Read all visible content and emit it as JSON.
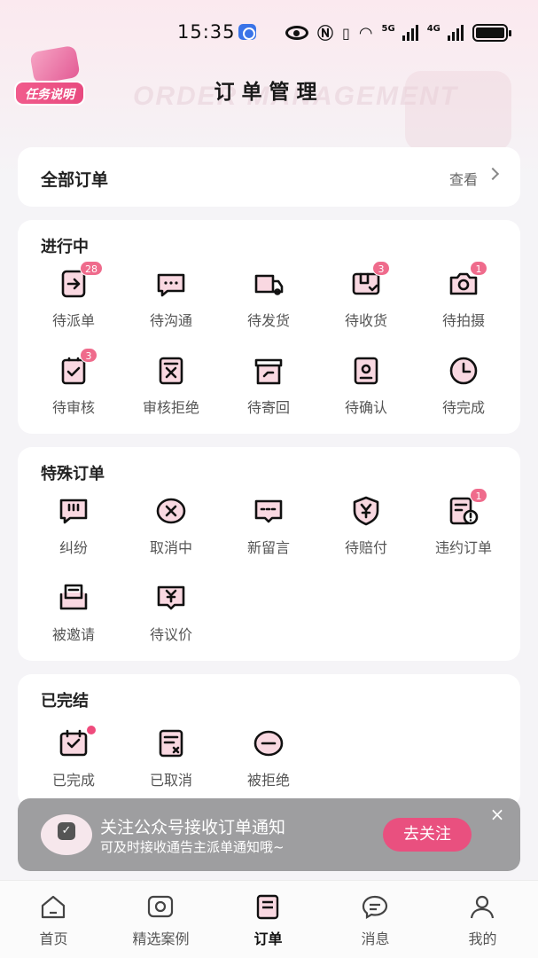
{
  "status_bar": {
    "time": "15:35",
    "network_1": "5G",
    "network_2": "4G"
  },
  "header": {
    "task_button": "任务说明",
    "title": "订单管理",
    "watermark": "ORDER MANAGEMENT"
  },
  "all_orders": {
    "title": "全部订单",
    "view_label": "查看"
  },
  "in_progress": {
    "title": "进行中",
    "items": [
      {
        "label": "待派单",
        "icon": "dispatch-icon",
        "badge": "28"
      },
      {
        "label": "待沟通",
        "icon": "chat-icon",
        "badge": ""
      },
      {
        "label": "待发货",
        "icon": "truck-icon",
        "badge": ""
      },
      {
        "label": "待收货",
        "icon": "receive-box-icon",
        "badge": "3"
      },
      {
        "label": "待拍摄",
        "icon": "camera-icon",
        "badge": "1"
      },
      {
        "label": "待审核",
        "icon": "review-doc-icon",
        "badge": "3"
      },
      {
        "label": "审核拒绝",
        "icon": "reject-doc-icon",
        "badge": ""
      },
      {
        "label": "待寄回",
        "icon": "return-box-icon",
        "badge": ""
      },
      {
        "label": "待确认",
        "icon": "confirm-doc-icon",
        "badge": ""
      },
      {
        "label": "待完成",
        "icon": "clock-icon",
        "badge": ""
      }
    ]
  },
  "special_orders": {
    "title": "特殊订单",
    "items": [
      {
        "label": "纠纷",
        "icon": "dispute-chat-icon",
        "badge": ""
      },
      {
        "label": "取消中",
        "icon": "cancel-circle-icon",
        "badge": ""
      },
      {
        "label": "新留言",
        "icon": "message-icon",
        "badge": ""
      },
      {
        "label": "待赔付",
        "icon": "shield-yen-icon",
        "badge": ""
      },
      {
        "label": "违约订单",
        "icon": "breach-doc-icon",
        "badge": "1"
      },
      {
        "label": "被邀请",
        "icon": "inbox-icon",
        "badge": ""
      },
      {
        "label": "待议价",
        "icon": "price-yen-icon",
        "badge": ""
      }
    ]
  },
  "finished": {
    "title": "已完结",
    "items": [
      {
        "label": "已完成",
        "icon": "calendar-check-icon",
        "dot": true
      },
      {
        "label": "已取消",
        "icon": "cancelled-doc-icon",
        "dot": false
      },
      {
        "label": "被拒绝",
        "icon": "minus-circle-icon",
        "dot": false
      }
    ]
  },
  "notification": {
    "title": "关注公众号接收订单通知",
    "subtitle": "可及时接收通告主派单通知哦~",
    "button": "去关注",
    "close": "×"
  },
  "tabbar": [
    {
      "label": "首页",
      "icon": "home-icon",
      "active": false
    },
    {
      "label": "精选案例",
      "icon": "featured-icon",
      "active": false
    },
    {
      "label": "订单",
      "icon": "order-icon",
      "active": true
    },
    {
      "label": "消息",
      "icon": "message-bubble-icon",
      "active": false
    },
    {
      "label": "我的",
      "icon": "profile-icon",
      "active": false
    }
  ],
  "colors": {
    "accent": "#ef6b8c",
    "primary_button": "#e9507f",
    "icon_fill": "#f9d8e1"
  }
}
